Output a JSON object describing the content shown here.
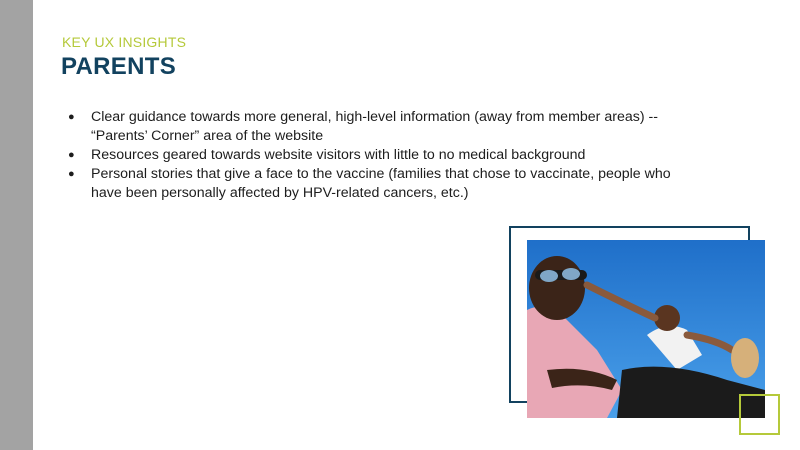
{
  "slide": {
    "kicker": "KEY UX INSIGHTS",
    "title": "PARENTS",
    "bullets": [
      {
        "line1": "Clear guidance towards more general, high-level information (away from member areas) --",
        "line2": "“Parents’ Corner” area of the website"
      },
      {
        "line1": "Resources geared towards website visitors with little to no medical background",
        "line2": ""
      },
      {
        "line1": "Personal stories that give a face to the vaccine (families that chose to vaccinate, people who",
        "line2": "have been personally affected by HPV-related cancers, etc.)"
      }
    ],
    "bullet_glyph": "●"
  },
  "colors": {
    "accent_green": "#b5c93a",
    "navy": "#12425f",
    "side_bar": "#a3a3a3",
    "sky_blue": "#2f86d8"
  },
  "image": {
    "subject": "father with sunglasses and child on his shoulders against blue sky"
  }
}
